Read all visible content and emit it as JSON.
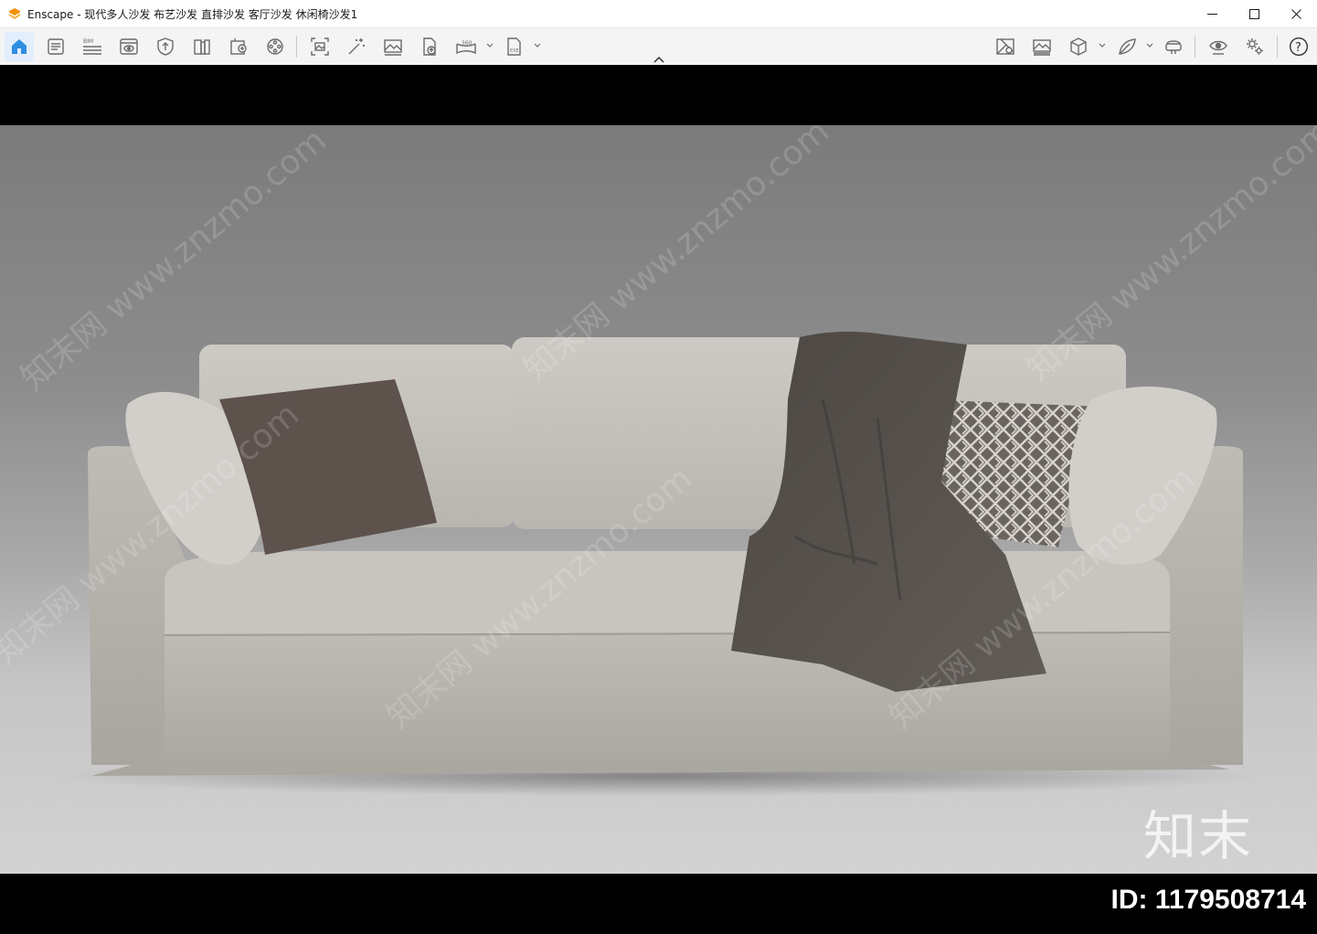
{
  "window": {
    "title": "Enscape - 现代多人沙发 布艺沙发 直排沙发 客厅沙发 休闲椅沙发1",
    "app_icon": "enscape-logo-icon",
    "controls": [
      "minimize-icon",
      "maximize-icon",
      "close-icon"
    ],
    "accent_color": "#f29100"
  },
  "toolbar": {
    "left_tools": [
      {
        "id": "home",
        "icon": "home-icon",
        "active": true
      },
      {
        "id": "views",
        "icon": "document-list-icon"
      },
      {
        "id": "bim",
        "icon": "bim-icon",
        "badge": "BIM"
      },
      {
        "id": "visual-settings",
        "icon": "eye-screen-icon"
      },
      {
        "id": "sync",
        "icon": "shield-icon"
      },
      {
        "id": "asset-library",
        "icon": "book-icon"
      },
      {
        "id": "material-editor",
        "icon": "image-plus-icon"
      },
      {
        "id": "video",
        "icon": "film-reel-icon"
      },
      {
        "id": "screenshot",
        "icon": "capture-frame-icon"
      },
      {
        "id": "render",
        "icon": "magic-wand-icon"
      },
      {
        "id": "gallery",
        "icon": "picture-icon"
      },
      {
        "id": "upload",
        "icon": "file-upload-icon"
      },
      {
        "id": "panorama",
        "icon": "panorama-360-icon",
        "badge": "360"
      },
      {
        "id": "export-exe",
        "icon": "exe-file-icon",
        "badge": "EXE"
      }
    ],
    "right_tools": [
      {
        "id": "clipping",
        "icon": "map-location-icon"
      },
      {
        "id": "batch-render",
        "icon": "images-stack-icon"
      },
      {
        "id": "views-cube",
        "icon": "cube-icon"
      },
      {
        "id": "sketch",
        "icon": "leaf-icon"
      },
      {
        "id": "vr",
        "icon": "vr-headset-icon"
      },
      {
        "id": "view-settings",
        "icon": "eye-settings-icon"
      },
      {
        "id": "settings",
        "icon": "gears-icon"
      },
      {
        "id": "help",
        "icon": "help-icon",
        "badge": "?"
      }
    ],
    "collapse_icon": "chevron-up-icon"
  },
  "viewport": {
    "description_colors": {
      "background": "#8d8d8d",
      "floor": "#d0d0d0",
      "sofa": "#c6c3bd",
      "throw": "#55504b"
    },
    "watermark_text": "知末网 www.znzmo.com",
    "logo_text": "知末",
    "id_label": "ID: 1179508714"
  }
}
